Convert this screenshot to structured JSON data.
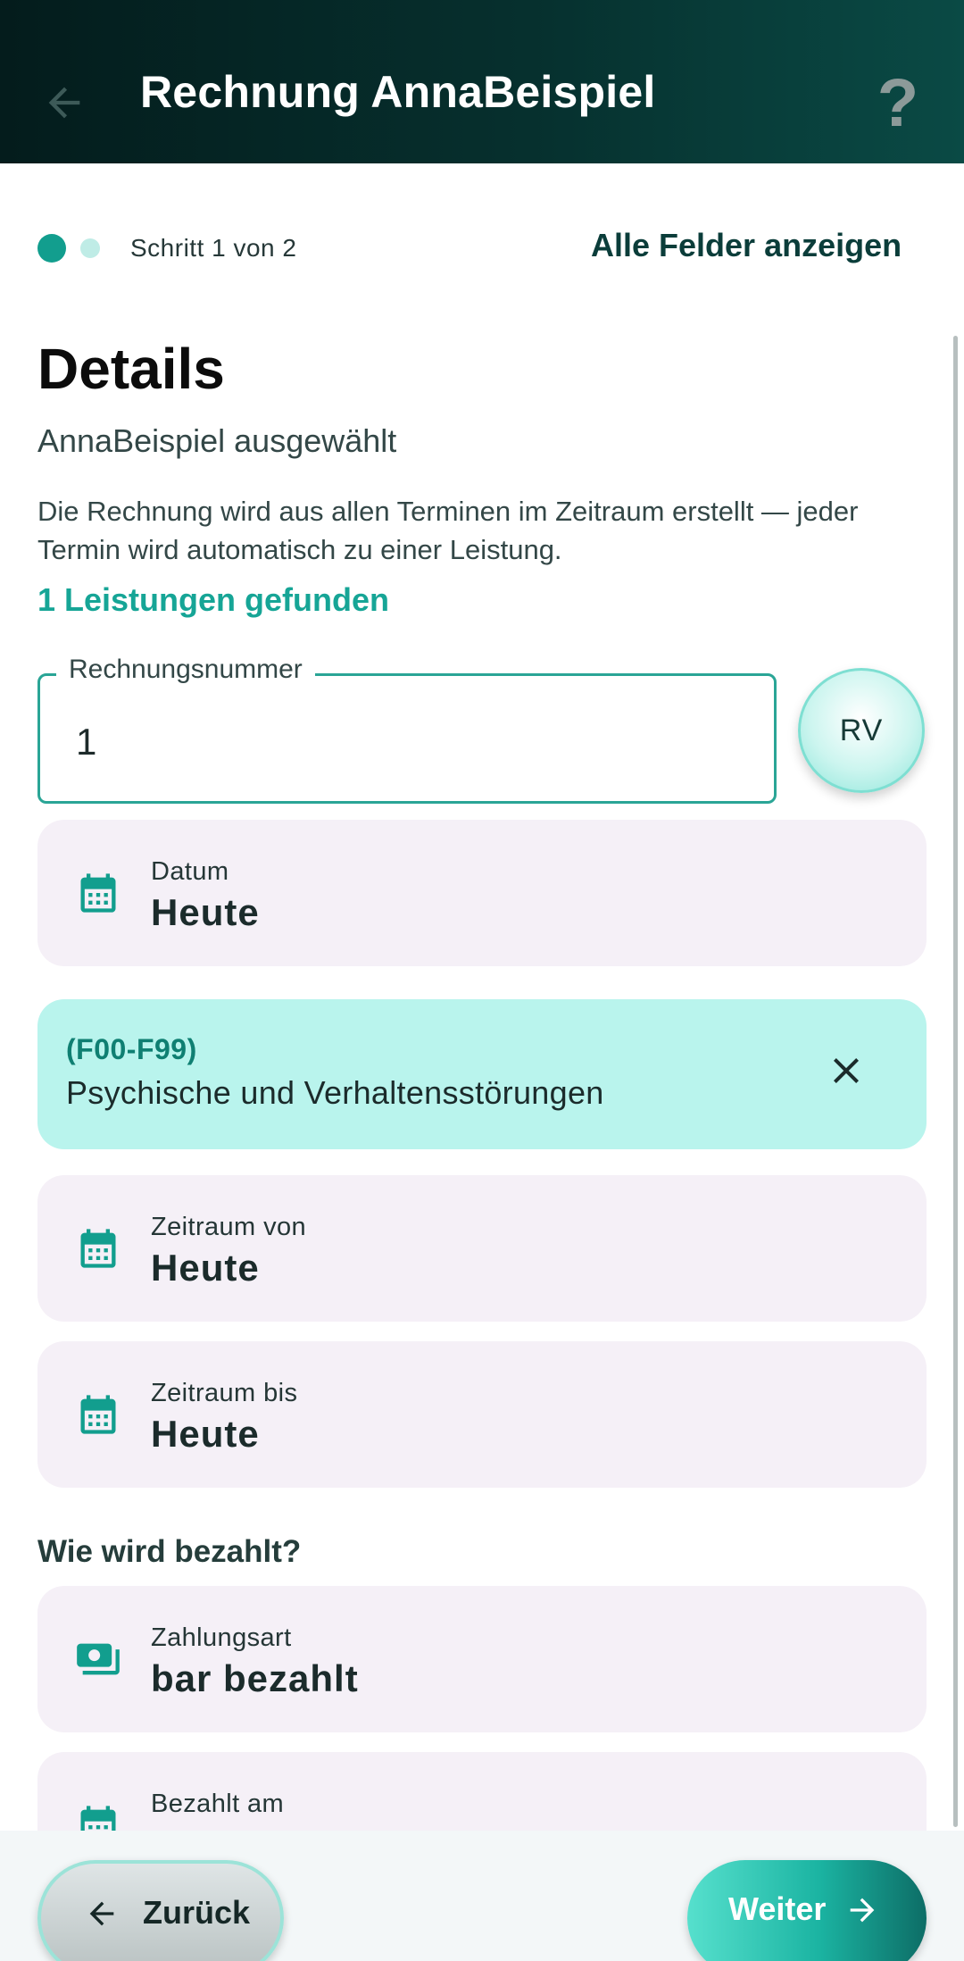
{
  "appbar": {
    "title": "Rechnung AnnaBeispiel",
    "help_label": "?"
  },
  "stepper": {
    "text": "Schritt 1 von 2",
    "show_all_label": "Alle Felder anzeigen"
  },
  "details": {
    "heading": "Details",
    "selected": "AnnaBeispiel ausgewählt",
    "description": "Die Rechnung wird aus allen Terminen im Zeitraum erstellt — jeder Termin wird automatisch zu einer Leistung.",
    "found": "1 Leistungen gefunden"
  },
  "invoice_number": {
    "label": "Rechnungsnummer",
    "value": "1",
    "rv_label": "RV"
  },
  "date_field": {
    "label": "Datum",
    "value": "Heute",
    "icon": "calendar-icon"
  },
  "diagnosis": {
    "code": "(F00-F99)",
    "text": "Psychische und Verhaltensstörungen",
    "icon": "close-icon"
  },
  "period_from": {
    "label": "Zeitraum von",
    "value": "Heute",
    "icon": "calendar-icon"
  },
  "period_to": {
    "label": "Zeitraum bis",
    "value": "Heute",
    "icon": "calendar-icon"
  },
  "payment": {
    "heading": "Wie wird bezahlt?",
    "method_label": "Zahlungsart",
    "method_value": "bar bezahlt",
    "method_icon": "cash-icon",
    "paid_on_label": "Bezahlt am",
    "paid_on_icon": "calendar-icon"
  },
  "footer": {
    "back_label": "Zurück",
    "next_label": "Weiter"
  },
  "colors": {
    "accent": "#129e8e",
    "appbar": "#06302e",
    "card": "#f5f0f7",
    "diagnosis_bg": "#b9f4ed"
  }
}
